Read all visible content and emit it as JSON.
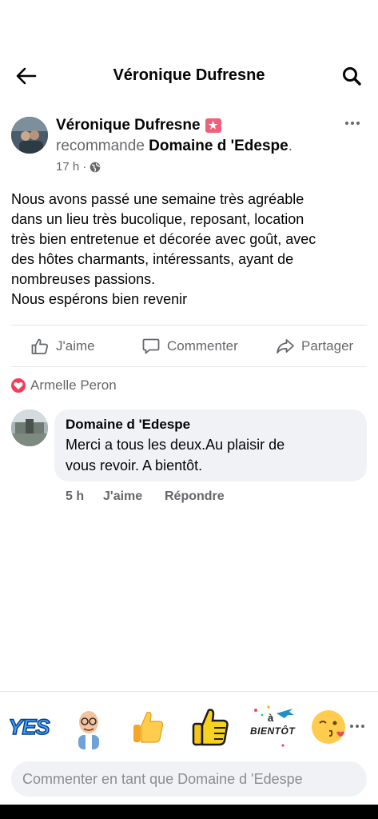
{
  "header": {
    "title": "Véronique Dufresne",
    "back_icon": "arrow-left-icon",
    "search_icon": "search-icon"
  },
  "post": {
    "author": "Véronique Dufresne",
    "badge_icon": "star-badge-icon",
    "recommends_word": "recommande",
    "recommended_page": "Domaine d 'Edespe",
    "recommended_suffix": ".",
    "time": "17 h",
    "time_separator": "·",
    "privacy_icon": "globe-icon",
    "text_lines": [
      "Nous avons passé une semaine très agréable",
      "dans un lieu très bucolique, reposant, location",
      "très bien entretenue et décorée avec goût, avec",
      "des hôtes charmants, intéressants, ayant de",
      "nombreuses passions.",
      "Nous espérons bien revenir"
    ]
  },
  "actions": {
    "like": "J'aime",
    "comment": "Commenter",
    "share": "Partager"
  },
  "reacted_by": {
    "name": "Armelle Peron",
    "icon": "heart-icon",
    "color": "#f33e58"
  },
  "comment": {
    "author": "Domaine d 'Edespe",
    "text_lines": [
      "Merci a tous les deux.Au plaisir de",
      "vous revoir. A bientôt."
    ],
    "time": "5 h",
    "like": "J'aime",
    "reply": "Répondre"
  },
  "stickers": [
    "yes-sticker",
    "memoji-sticker",
    "thumbs-up-emoji",
    "thumbs-up-sticker",
    "a-bientot-sticker",
    "blowing-kiss-emoji"
  ],
  "stickers_text": {
    "yes": "YES",
    "bientot_a": "à",
    "bientot": "BIENTÔT"
  },
  "composer": {
    "placeholder": "Commenter en tant que Domaine d 'Edespe"
  }
}
